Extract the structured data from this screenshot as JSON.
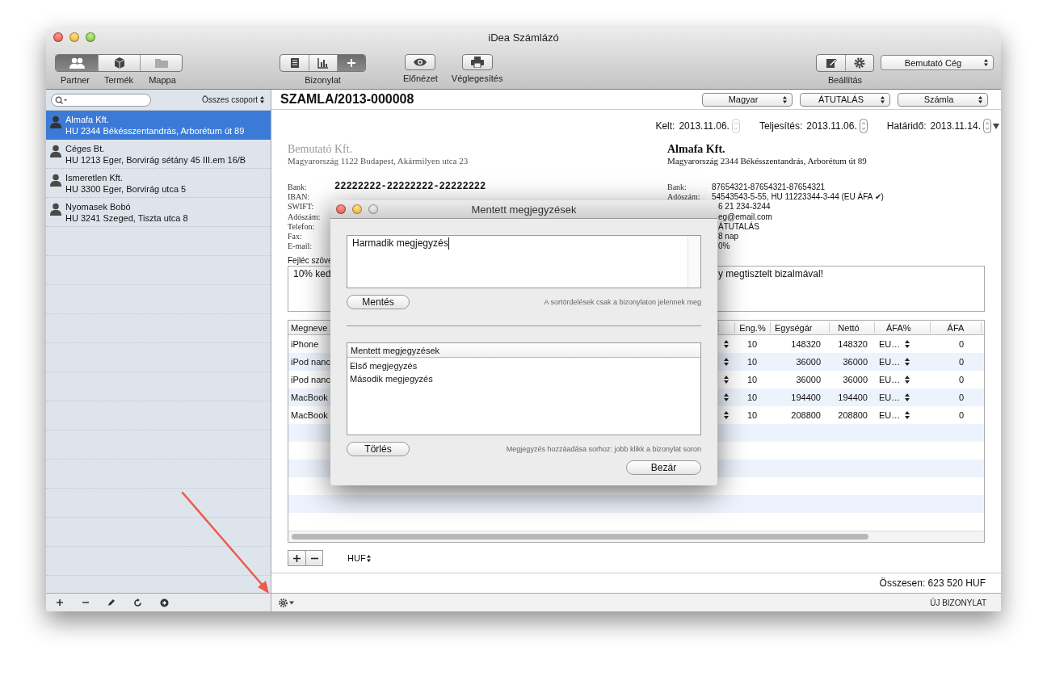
{
  "window": {
    "title": "iDea Számlázó"
  },
  "toolbar": {
    "views": [
      {
        "label": "Partner",
        "selected": true,
        "disabled": false
      },
      {
        "label": "Termék",
        "selected": false,
        "disabled": false
      },
      {
        "label": "Mappa",
        "selected": false,
        "disabled": true
      }
    ],
    "document_label": "Bizonylat",
    "document_buttons": [
      {
        "selected": false
      },
      {
        "selected": false
      },
      {
        "selected": true
      }
    ],
    "preview_label": "Előnézet",
    "finalize_label": "Véglegesítés",
    "settings_label": "Beállítás",
    "company": "Bemutató Cég"
  },
  "sidebar": {
    "group_filter": "Összes csoport",
    "partners": [
      {
        "name": "Almafa Kft.",
        "address": "HU 2344 Békésszentandrás, Arborétum út 89",
        "selected": true
      },
      {
        "name": "Céges Bt.",
        "address": "HU 1213 Eger, Borvirág sétány 45 III.em 16/B",
        "selected": false
      },
      {
        "name": "Ismeretlen Kft.",
        "address": "HU 3300 Eger, Borvirág utca 5",
        "selected": false
      },
      {
        "name": "Nyomasek Bobó",
        "address": "HU 3241 Szeged, Tiszta utca 8",
        "selected": false
      }
    ]
  },
  "document": {
    "number": "SZAMLA/2013-000008",
    "popups": [
      "Magyar",
      "ÁTUTALÁS",
      "Számla"
    ],
    "dates": [
      {
        "label": "Kelt:",
        "value": "2013.11.06.",
        "disabled": true
      },
      {
        "label": "Teljesítés:",
        "value": "2013.11.06.",
        "disabled": false
      },
      {
        "label": "Határidő:",
        "value": "2013.11.14.",
        "disabled": false
      }
    ],
    "seller": {
      "name": "Bemutató Kft.",
      "address": "Magyarország 1122 Budapest, Akármilyen utca 23",
      "fields": [
        {
          "label": "Bank:",
          "value": "22222222-22222222-22222222"
        },
        {
          "label": "IBAN:"
        },
        {
          "label": "SWIFT:"
        },
        {
          "label": "Adószám:"
        },
        {
          "label": "Telefon:"
        },
        {
          "label": "Fax:"
        },
        {
          "label": "E-mail:"
        }
      ]
    },
    "buyer": {
      "name": "Almafa Kft.",
      "address": "Magyarország 2344 Békésszentandrás, Arborétum út 89",
      "fields": [
        {
          "label": "Bank:",
          "value": "87654321-87654321-87654321"
        },
        {
          "label": "Adószám:",
          "value": "54543543-5-55, HU 11223344-3-44 (EU ÁFA ✔)"
        },
        {
          "value": "6 21 234-3244"
        },
        {
          "value": "eg@email.com"
        },
        {
          "value": "ÁTUTALÁS"
        },
        {
          "value": "8 nap"
        },
        {
          "value": "0%"
        }
      ]
    },
    "header_text": {
      "label": "Fejléc szöve",
      "text_start": "10% ked",
      "text_end": "y megtisztelt bizalmával!"
    },
    "items": {
      "name_column": "Megneve",
      "columns": [
        "Eng.%",
        "Egységár",
        "Nettó",
        "ÁFA%",
        "ÁFA"
      ],
      "rows": [
        {
          "name": "iPhone",
          "discount": "10",
          "unit_price": "148320",
          "net": "148320",
          "vat_rate": "EU…",
          "vat": "0"
        },
        {
          "name": "iPod nanc",
          "discount": "10",
          "unit_price": "36000",
          "net": "36000",
          "vat_rate": "EU…",
          "vat": "0"
        },
        {
          "name": "iPod nanc",
          "discount": "10",
          "unit_price": "36000",
          "net": "36000",
          "vat_rate": "EU…",
          "vat": "0"
        },
        {
          "name": "MacBook",
          "discount": "10",
          "unit_price": "194400",
          "net": "194400",
          "vat_rate": "EU…",
          "vat": "0"
        },
        {
          "name": "MacBook",
          "discount": "10",
          "unit_price": "208800",
          "net": "208800",
          "vat_rate": "EU…",
          "vat": "0"
        }
      ]
    },
    "currency": "HUF",
    "total": "Összesen: 623 520 HUF",
    "new_document": "ÚJ BIZONYLAT"
  },
  "dialog": {
    "title": "Mentett megjegyzések",
    "note": "Harmadik megjegyzés",
    "save": "Mentés",
    "save_hint": "A sortördelések csak a bizonylaton jelennek meg",
    "list_header": "Mentett megjegyzések",
    "notes": [
      "Első megjegyzés",
      "Második megjegyzés"
    ],
    "delete": "Törlés",
    "delete_hint": "Megjegyzés hozzáadása sorhoz: jobb klikk a bizonylat soron",
    "close": "Bezár"
  }
}
